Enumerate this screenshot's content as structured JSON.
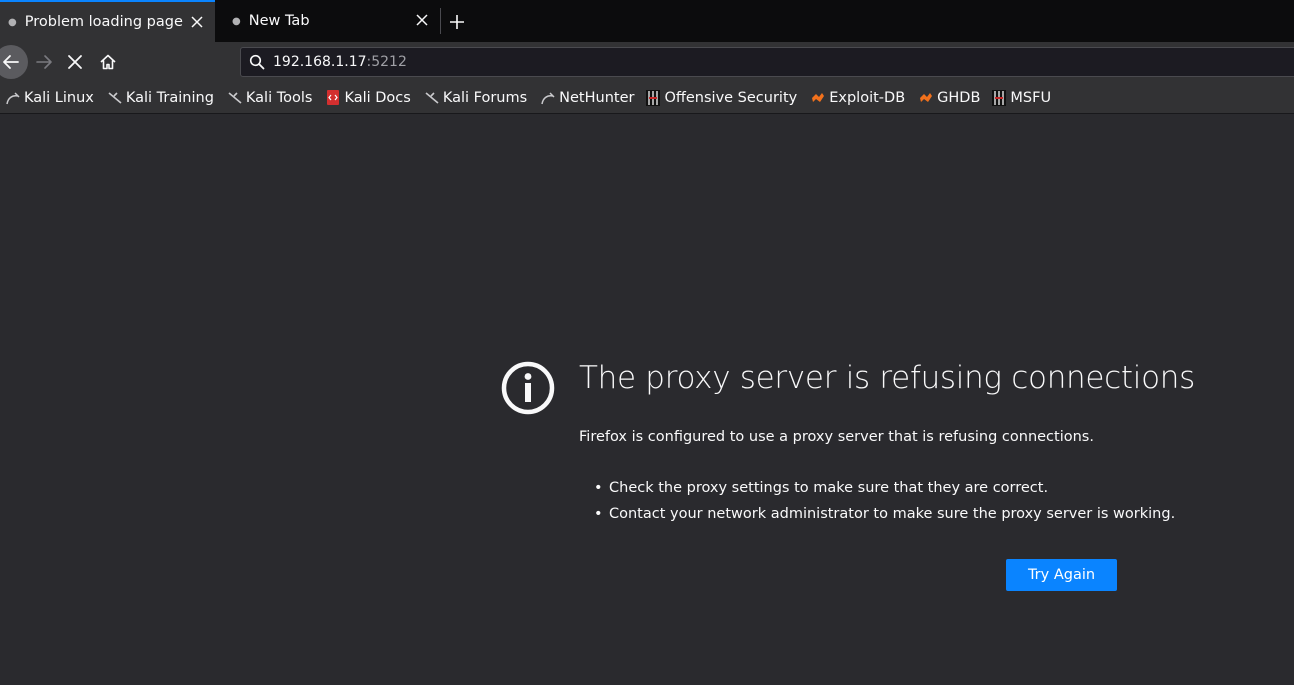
{
  "tabs": [
    {
      "label": "Problem loading page",
      "active": true
    },
    {
      "label": "New Tab",
      "active": false
    }
  ],
  "navbar": {
    "url_host": "192.168.1.17",
    "url_port": ":5212"
  },
  "bookmarks": [
    {
      "label": "Kali Linux",
      "icon": "kali-dragon-icon"
    },
    {
      "label": "Kali Training",
      "icon": "kali-dragon-icon"
    },
    {
      "label": "Kali Tools",
      "icon": "kali-dragon-icon"
    },
    {
      "label": "Kali Docs",
      "icon": "kali-docs-icon"
    },
    {
      "label": "Kali Forums",
      "icon": "kali-dragon-icon"
    },
    {
      "label": "NetHunter",
      "icon": "nethunter-icon"
    },
    {
      "label": "Offensive Security",
      "icon": "offsec-icon"
    },
    {
      "label": "Exploit-DB",
      "icon": "exploit-db-icon"
    },
    {
      "label": "GHDB",
      "icon": "exploit-db-icon"
    },
    {
      "label": "MSFU",
      "icon": "offsec-icon"
    }
  ],
  "error": {
    "title": "The proxy server is refusing connections",
    "description": "Firefox is configured to use a proxy server that is refusing connections.",
    "items": [
      "Check the proxy settings to make sure that they are correct.",
      "Contact your network administrator to make sure the proxy server is working."
    ],
    "button_label": "Try Again"
  },
  "colors": {
    "accent": "#0a84ff",
    "page_bg": "#2a2a2e",
    "toolbar_bg": "#323234",
    "tabstrip_bg": "#0c0c0d"
  }
}
